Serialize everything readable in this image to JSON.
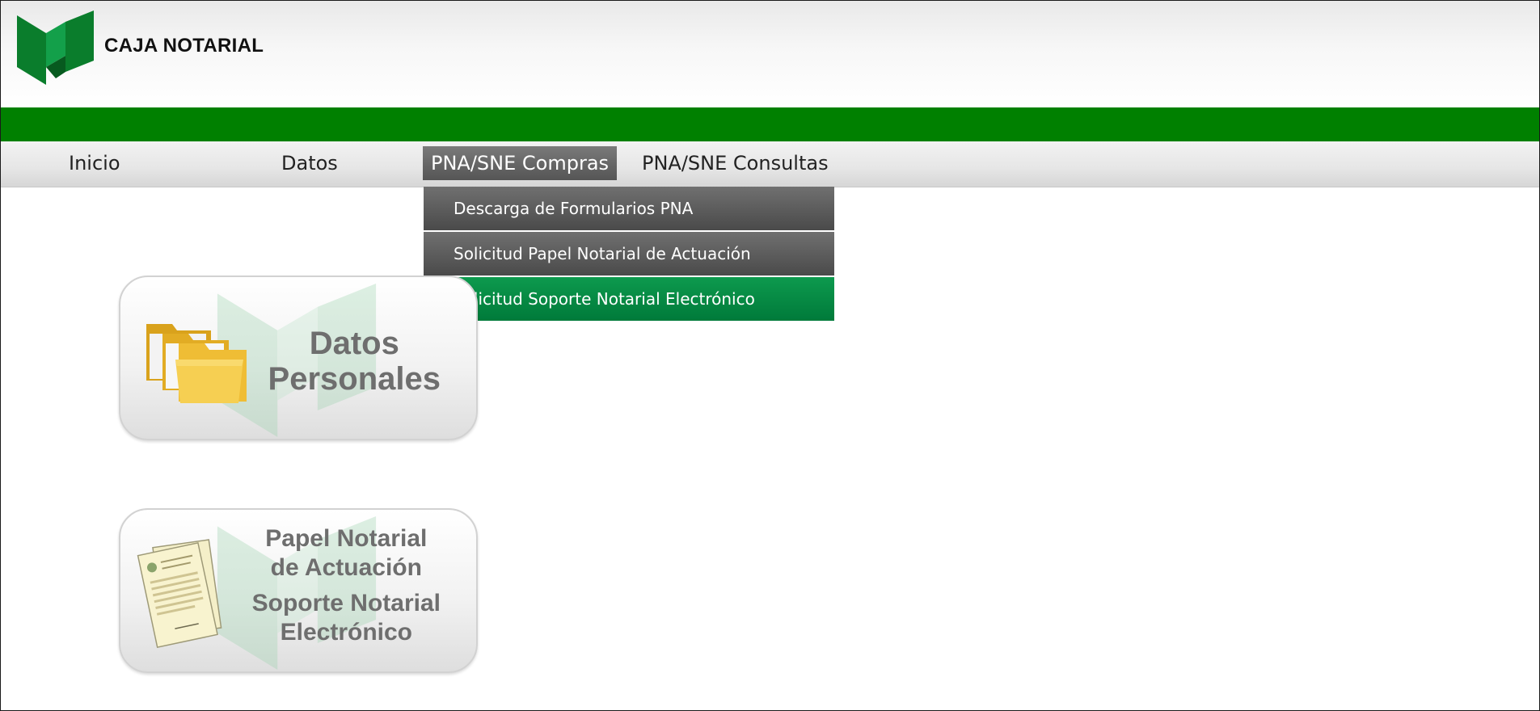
{
  "brand": {
    "name": "CAJA NOTARIAL",
    "logo": "caja-notarial-logo",
    "primary_color": "#008000",
    "accent_color": "#009a4e"
  },
  "nav": {
    "items": [
      {
        "label": "Inicio"
      },
      {
        "label": "Datos"
      },
      {
        "label": "PNA/SNE Compras",
        "active": true
      },
      {
        "label": "PNA/SNE Consultas"
      }
    ]
  },
  "dropdown": {
    "items": [
      {
        "label": "Descarga de Formularios PNA"
      },
      {
        "label": "Solicitud Papel Notarial de Actuación"
      },
      {
        "label": "Solicitud Soporte Notarial Electrónico",
        "highlighted": true
      }
    ]
  },
  "cards": [
    {
      "icon": "folders-icon",
      "lines": [
        "Datos",
        "Personales"
      ]
    },
    {
      "icon": "notarial-paper-icon",
      "lines": [
        "Papel Notarial",
        "de Actuación",
        "Soporte Notarial",
        "Electrónico"
      ]
    }
  ]
}
